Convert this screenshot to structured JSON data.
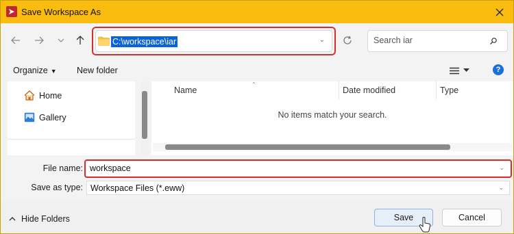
{
  "window": {
    "title": "Save Workspace As",
    "title_bar_color": "#f9bc0f",
    "app_icon": "red-app-icon",
    "close_icon": "close-icon"
  },
  "nav": {
    "back_icon": "arrow-left-icon",
    "forward_icon": "arrow-right-icon",
    "recent_icon": "chevron-down-icon",
    "up_icon": "arrow-up-icon"
  },
  "address": {
    "path": "C:\\workspace\\iar",
    "folder_icon": "folder-icon",
    "selection_color": "#0a64d8",
    "highlight_color": "#d32f2f"
  },
  "search": {
    "placeholder": "Search iar",
    "icon": "search-icon"
  },
  "toolbar": {
    "organize_label": "Organize",
    "new_folder_label": "New folder",
    "view_icon": "view-menu-icon",
    "help_icon": "help-icon",
    "help_glyph": "?"
  },
  "sidebar": {
    "items": [
      {
        "label": "Home",
        "icon": "home-icon"
      },
      {
        "label": "Gallery",
        "icon": "gallery-icon"
      }
    ]
  },
  "file_list": {
    "columns": [
      "Name",
      "Date modified",
      "Type"
    ],
    "empty_message": "No items match your search."
  },
  "form": {
    "file_name_label": "File name:",
    "file_name_value": "workspace",
    "save_as_type_label": "Save as type:",
    "save_as_type_value": "Workspace Files (*.eww)"
  },
  "footer": {
    "hide_folders_label": "Hide Folders",
    "save_label": "Save",
    "cancel_label": "Cancel"
  }
}
